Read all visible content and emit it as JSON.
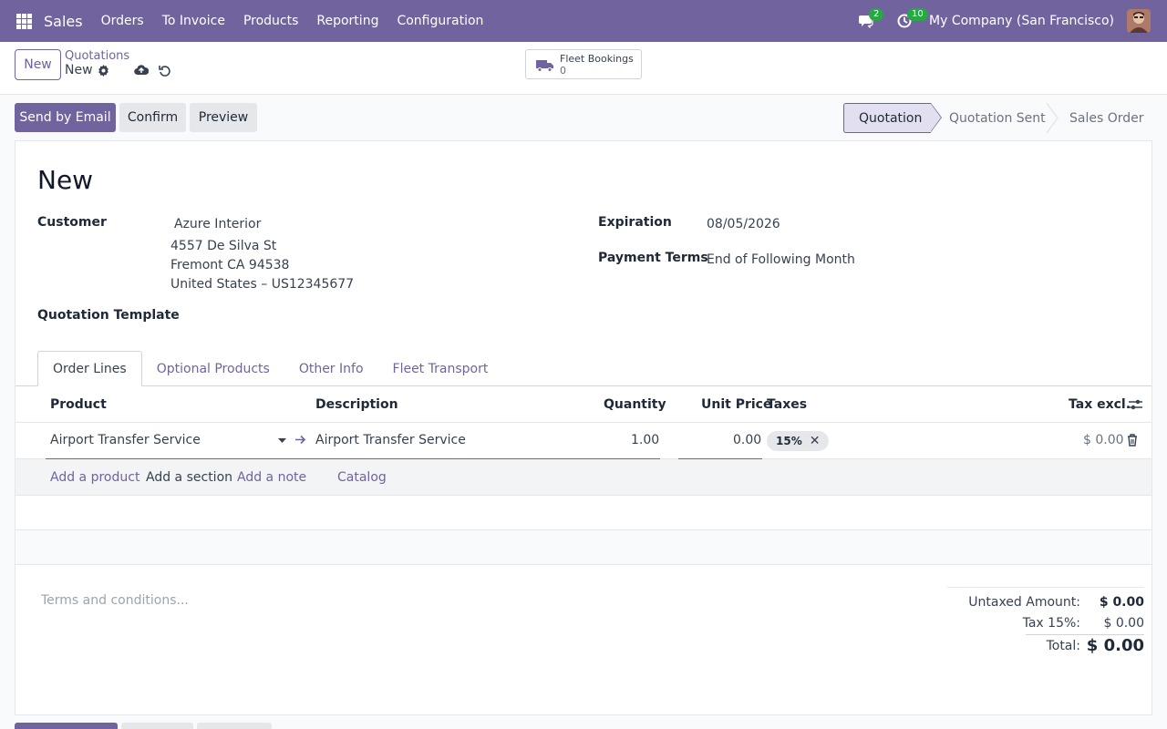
{
  "navbar": {
    "app_name": "Sales",
    "menu": [
      "Orders",
      "To Invoice",
      "Products",
      "Reporting",
      "Configuration"
    ],
    "messages_count": "2",
    "activities_count": "10",
    "company": "My Company (San Francisco)",
    "color": "#71639e"
  },
  "control": {
    "new_label": "New",
    "breadcrumb_parent": "Quotations",
    "breadcrumb_current": "New",
    "fleet_label": "Fleet Bookings",
    "fleet_count": "0"
  },
  "actions": {
    "send_email": "Send by Email",
    "confirm": "Confirm",
    "preview": "Preview"
  },
  "status": {
    "stages": [
      "Quotation",
      "Quotation Sent",
      "Sales Order"
    ],
    "active": "Quotation"
  },
  "form": {
    "title": "New",
    "customer_label": "Customer",
    "customer_name": "Azure Interior",
    "address_line1": "4557 De Silva St",
    "address_line2": "Fremont CA 94538",
    "address_line3": "United States – US12345677",
    "template_label": "Quotation Template",
    "expiration_label": "Expiration",
    "expiration_value": "08/05/2026",
    "payment_terms_label": "Payment Terms",
    "payment_terms_value": "End of Following Month"
  },
  "tabs": [
    "Order Lines",
    "Optional Products",
    "Other Info",
    "Fleet Transport"
  ],
  "lines": {
    "headers": {
      "product": "Product",
      "description": "Description",
      "quantity": "Quantity",
      "unit_price": "Unit Price",
      "taxes": "Taxes",
      "tax_excl": "Tax excl."
    },
    "rows": [
      {
        "product": "Airport Transfer Service",
        "description": "Airport Transfer Service",
        "quantity": "1.00",
        "unit_price": "0.00",
        "tax": "15%",
        "subtotal": "$ 0.00"
      }
    ],
    "add_product": "Add a product",
    "add_section": "Add a section",
    "add_note": "Add a note",
    "catalog": "Catalog"
  },
  "footer": {
    "terms_placeholder": "Terms and conditions...",
    "untaxed_label": "Untaxed Amount:",
    "untaxed_value": "$ 0.00",
    "tax_label": "Tax 15%:",
    "tax_value": "$ 0.00",
    "total_label": "Total:",
    "total_value": "$ 0.00"
  }
}
